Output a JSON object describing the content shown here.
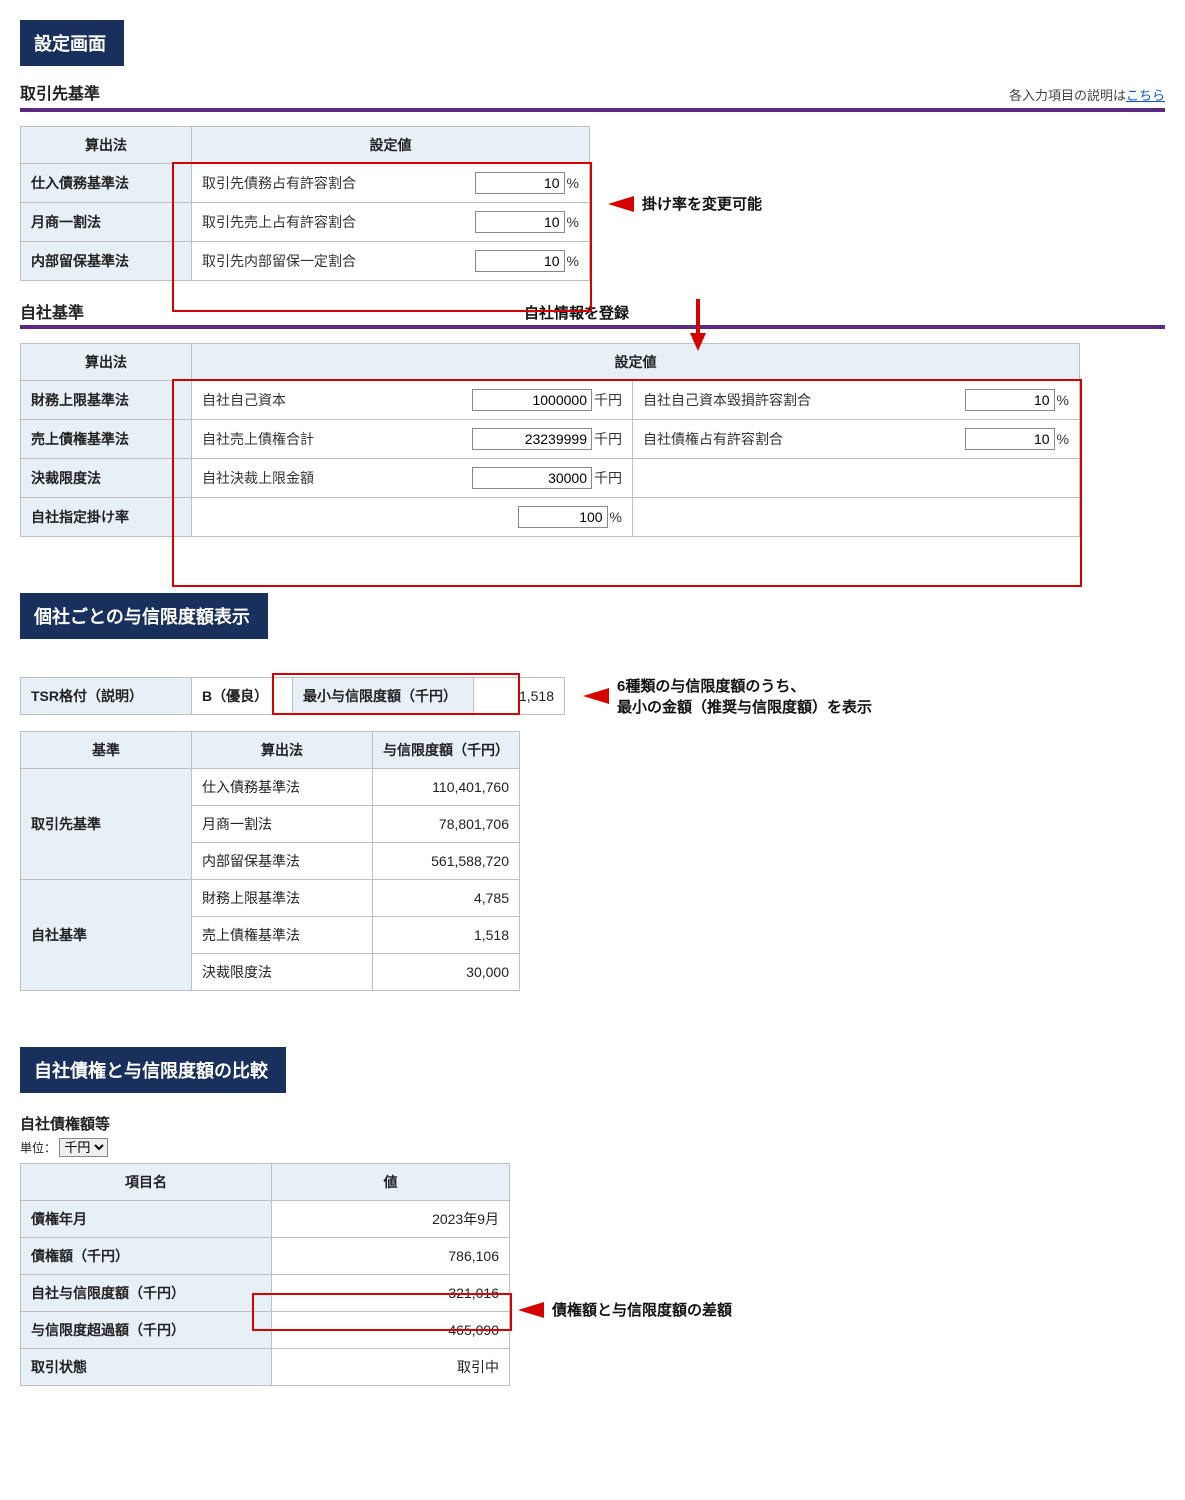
{
  "sections": {
    "settings_title": "設定画面",
    "credit_display_title": "個社ごとの与信限度額表示",
    "comparison_title": "自社債権と与信限度額の比較"
  },
  "partner": {
    "heading": "取引先基準",
    "help_prefix": "各入力項目の説明は",
    "help_link": "こちら",
    "col_method": "算出法",
    "col_setting": "設定値",
    "rows": [
      {
        "method": "仕入債務基準法",
        "label": "取引先債務占有許容割合",
        "value": "10",
        "unit": "%"
      },
      {
        "method": "月商一割法",
        "label": "取引先売上占有許容割合",
        "value": "10",
        "unit": "%"
      },
      {
        "method": "内部留保基準法",
        "label": "取引先内部留保一定割合",
        "value": "10",
        "unit": "%"
      }
    ],
    "annotation": "掛け率を変更可能"
  },
  "own": {
    "heading": "自社基準",
    "annotation_top": "自社情報を登録",
    "col_method": "算出法",
    "col_setting": "設定値",
    "rows": [
      {
        "method": "財務上限基準法",
        "l1": "自社自己資本",
        "v1": "1000000",
        "u1": "千円",
        "l2": "自社自己資本毀損許容割合",
        "v2": "10",
        "u2": "%"
      },
      {
        "method": "売上債権基準法",
        "l1": "自社売上債権合計",
        "v1": "23239999",
        "u1": "千円",
        "l2": "自社債権占有許容割合",
        "v2": "10",
        "u2": "%"
      },
      {
        "method": "決裁限度法",
        "l1": "自社決裁上限金額",
        "v1": "30000",
        "u1": "千円",
        "l2": "",
        "v2": "",
        "u2": ""
      }
    ],
    "rate_row": {
      "method": "自社指定掛け率",
      "value": "100",
      "unit": "%"
    }
  },
  "credit": {
    "tsr_label": "TSR格付（説明）",
    "tsr_value": "B（優良）",
    "min_label": "最小与信限度額（千円）",
    "min_value": "1,518",
    "annotation_line1": "6種類の与信限度額のうち、",
    "annotation_line2": "最小の金額（推奨与信限度額）を表示",
    "cols": {
      "std": "基準",
      "method": "算出法",
      "limit": "与信限度額（千円）"
    },
    "group1": "取引先基準",
    "group2": "自社基準",
    "rows": [
      {
        "method": "仕入債務基準法",
        "limit": "110,401,760"
      },
      {
        "method": "月商一割法",
        "limit": "78,801,706"
      },
      {
        "method": "内部留保基準法",
        "limit": "561,588,720"
      },
      {
        "method": "財務上限基準法",
        "limit": "4,785"
      },
      {
        "method": "売上債権基準法",
        "limit": "1,518"
      },
      {
        "method": "決裁限度法",
        "limit": "30,000"
      }
    ]
  },
  "comparison": {
    "subheading": "自社債権額等",
    "unit_prefix": "単位：",
    "unit_option": "千円",
    "col_name": "項目名",
    "col_value": "値",
    "rows": [
      {
        "name": "債権年月",
        "value": "2023年9月"
      },
      {
        "name": "債権額（千円）",
        "value": "786,106"
      },
      {
        "name": "自社与信限度額（千円）",
        "value": "321,016"
      },
      {
        "name": "与信限度超過額（千円）",
        "value": "465,090"
      },
      {
        "name": "取引状態",
        "value": "取引中"
      }
    ],
    "annotation": "債権額と与信限度額の差額"
  }
}
